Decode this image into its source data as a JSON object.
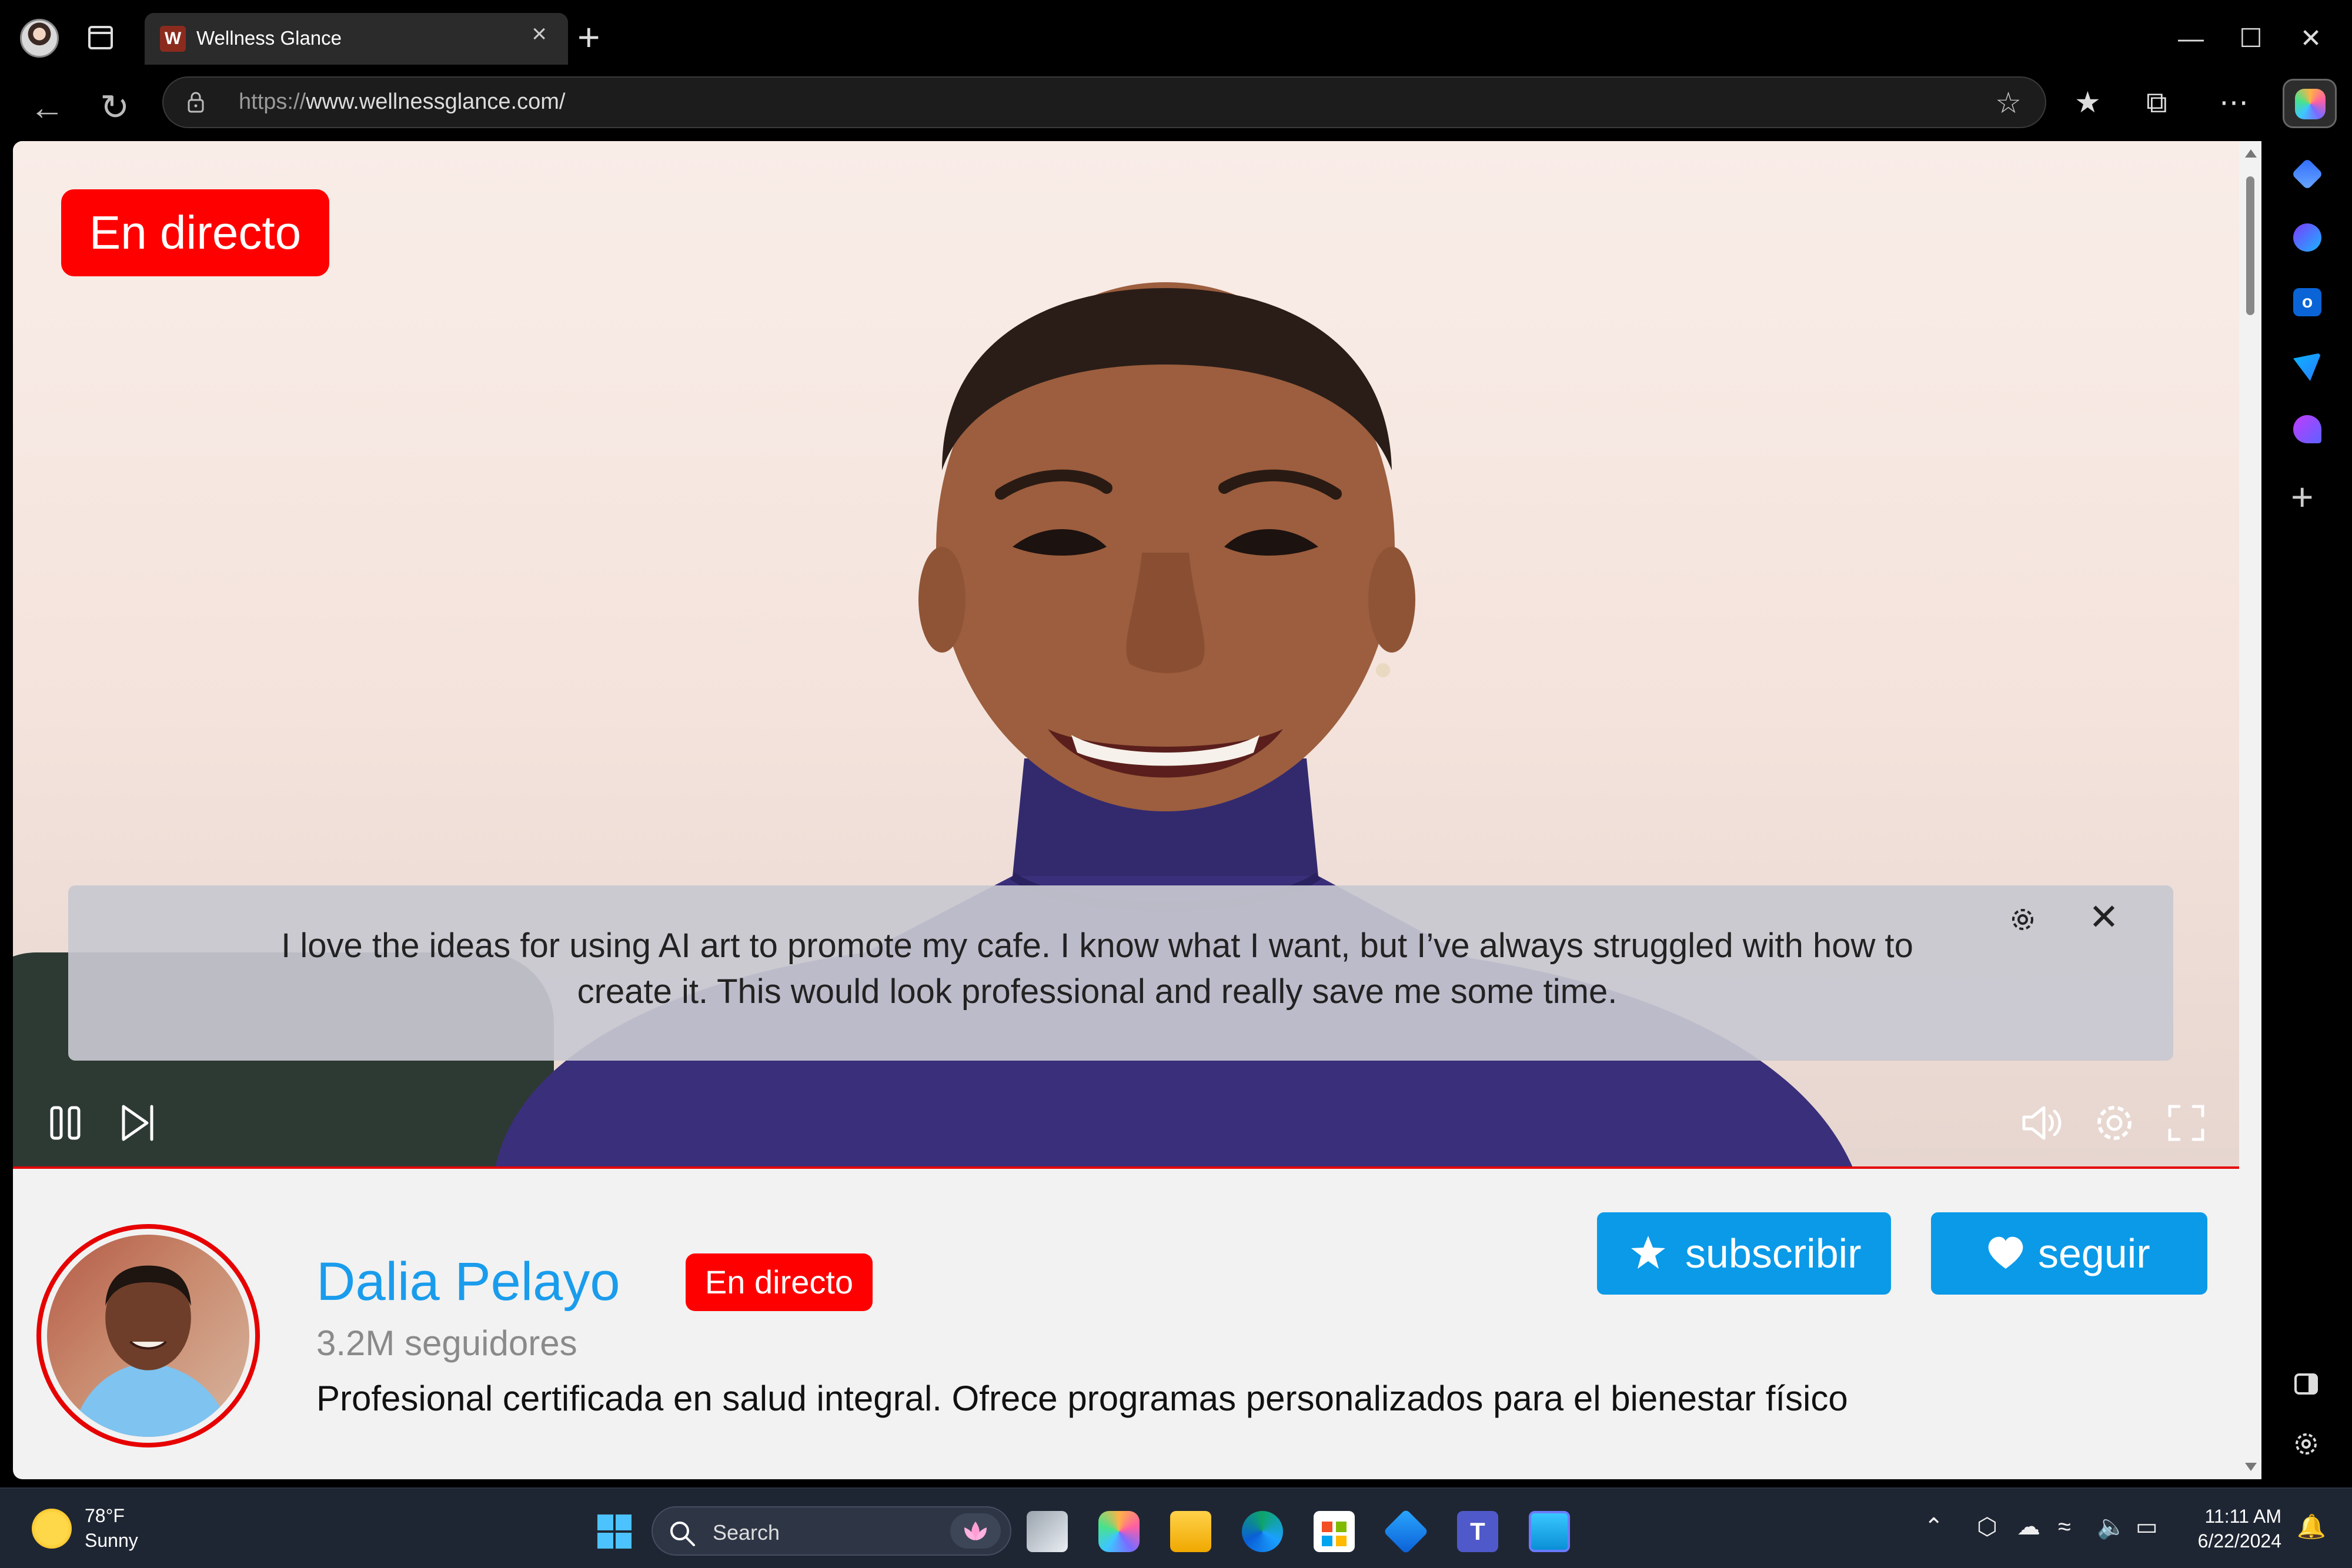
{
  "browser": {
    "tab_title": "Wellness Glance",
    "tab_favicon_letter": "W",
    "url_prefix": "https://",
    "url_main": "www.wellnessglance.com/",
    "new_tab": "+",
    "close_tab": "×"
  },
  "video": {
    "live_badge": "En directo",
    "caption": "I love the ideas for using AI art to promote my cafe. I know what I want, but I’ve always struggled with how to create it. This would look professional and really save me some time.",
    "progress": 1.0
  },
  "channel": {
    "name": "Dalia Pelayo",
    "live_chip": "En directo",
    "followers": "3.2M seguidores",
    "bio": "Profesional certificada en salud integral. Ofrece programas personalizados para el bienestar físico",
    "subscribe_label": "subscribir",
    "follow_label": "seguir"
  },
  "taskbar": {
    "temperature": "78°F",
    "condition": "Sunny",
    "search_placeholder": "Search",
    "time": "11:11 AM",
    "date": "6/22/2024"
  },
  "colors": {
    "live_red": "#ff0000",
    "accent_blue": "#0a9ae8",
    "name_blue": "#1a9cec"
  },
  "icons": [
    "profile-avatar",
    "tab-actions-icon",
    "refresh-icon",
    "back-icon",
    "lock-icon",
    "add-favorite-icon",
    "favorites-icon",
    "collections-icon",
    "more-icon",
    "copilot-icon",
    "pause-icon",
    "skip-next-icon",
    "volume-icon",
    "settings-icon",
    "fullscreen-icon",
    "star-icon",
    "heart-icon",
    "windows-start-icon",
    "search-icon"
  ]
}
